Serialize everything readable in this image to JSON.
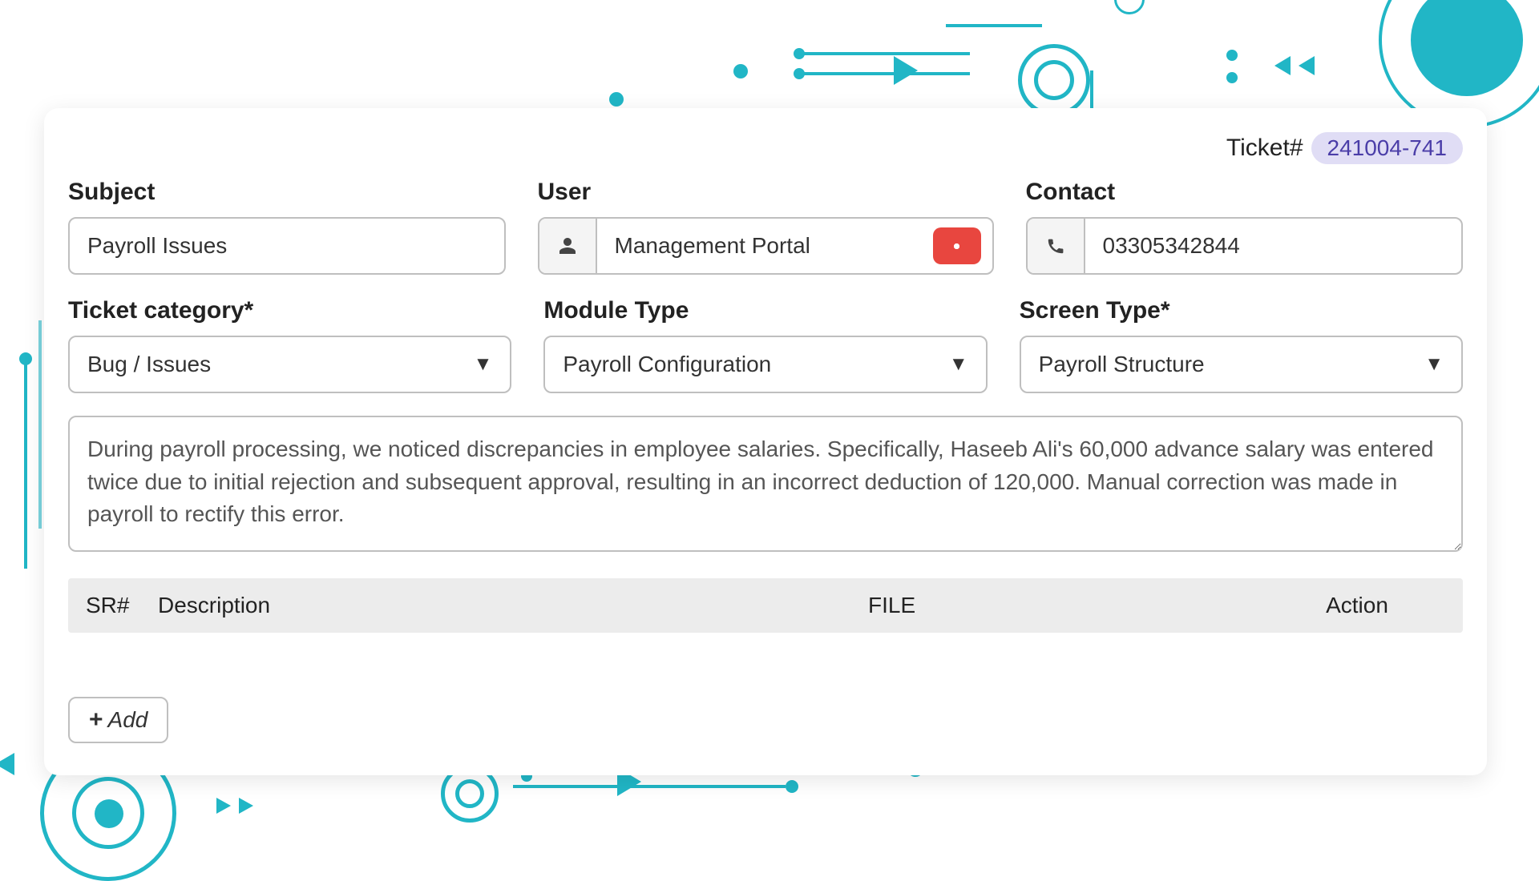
{
  "ticket": {
    "label": "Ticket#",
    "number": "241004-741"
  },
  "fields": {
    "subject": {
      "label": "Subject",
      "value": "Payroll Issues"
    },
    "user": {
      "label": "User",
      "value": "Management Portal"
    },
    "contact": {
      "label": "Contact",
      "value": "03305342844"
    },
    "category": {
      "label": "Ticket category*",
      "value": "Bug / Issues"
    },
    "module": {
      "label": "Module Type",
      "value": "Payroll Configuration"
    },
    "screen": {
      "label": "Screen Type*",
      "value": "Payroll Structure"
    }
  },
  "description": "During payroll processing, we noticed discrepancies in employee salaries. Specifically, Haseeb Ali's 60,000 advance salary was entered twice due to initial rejection and subsequent approval, resulting in an incorrect deduction of 120,000. Manual correction was made in payroll to rectify this error.",
  "attachments": {
    "headers": {
      "sr": "SR#",
      "description": "Description",
      "file": "FILE",
      "action": "Action"
    }
  },
  "buttons": {
    "add": "Add"
  }
}
